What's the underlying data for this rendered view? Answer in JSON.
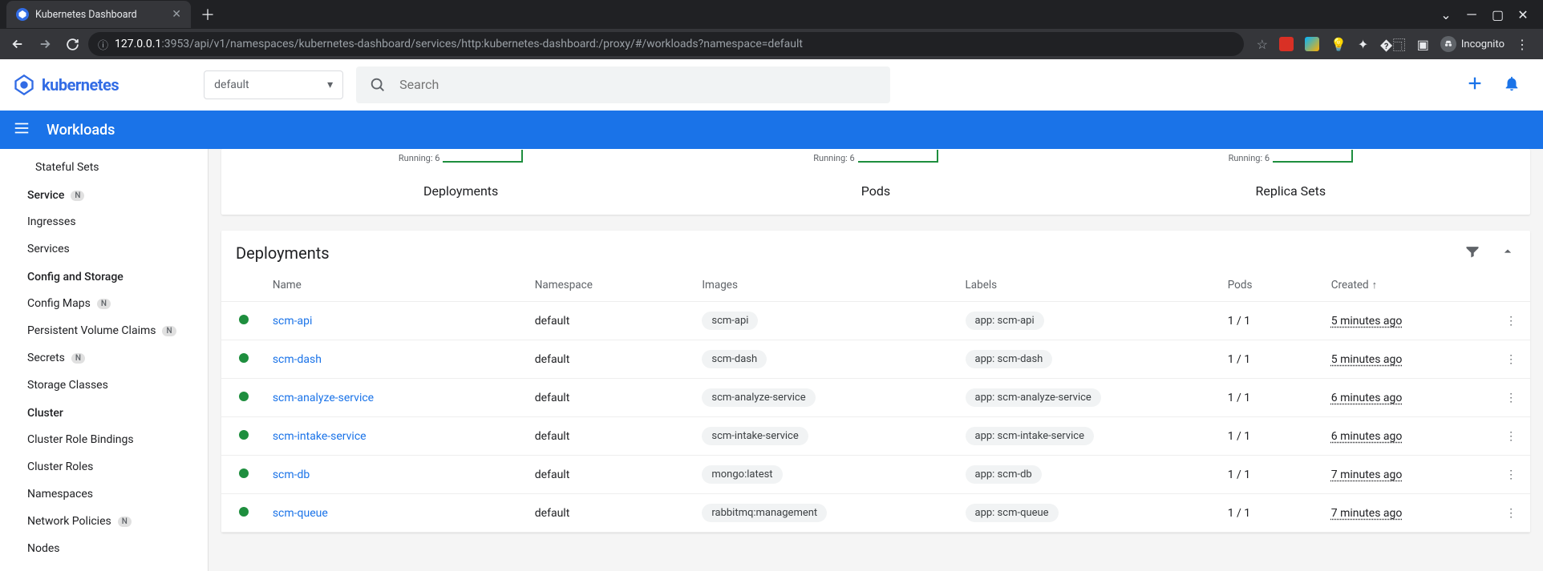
{
  "browser": {
    "tab_title": "Kubernetes Dashboard",
    "url_host": "127.0.0.1",
    "url_port": ":3953",
    "url_path": "/api/v1/namespaces/kubernetes-dashboard/services/http:kubernetes-dashboard:/proxy/#/workloads?namespace=default",
    "incognito_label": "Incognito"
  },
  "header": {
    "brand": "kubernetes",
    "namespace_selected": "default",
    "search_placeholder": "Search"
  },
  "page": {
    "title": "Workloads"
  },
  "sidebar": {
    "items": [
      {
        "label": "Stateful Sets",
        "type": "item"
      },
      {
        "label": "Service",
        "type": "section",
        "badge": "N"
      },
      {
        "label": "Ingresses",
        "type": "item"
      },
      {
        "label": "Services",
        "type": "item"
      },
      {
        "label": "Config and Storage",
        "type": "section"
      },
      {
        "label": "Config Maps",
        "type": "item",
        "badge": "N"
      },
      {
        "label": "Persistent Volume Claims",
        "type": "item",
        "badge": "N"
      },
      {
        "label": "Secrets",
        "type": "item",
        "badge": "N"
      },
      {
        "label": "Storage Classes",
        "type": "item"
      },
      {
        "label": "Cluster",
        "type": "section"
      },
      {
        "label": "Cluster Role Bindings",
        "type": "item"
      },
      {
        "label": "Cluster Roles",
        "type": "item"
      },
      {
        "label": "Namespaces",
        "type": "item"
      },
      {
        "label": "Network Policies",
        "type": "item",
        "badge": "N"
      },
      {
        "label": "Nodes",
        "type": "item"
      }
    ]
  },
  "status": {
    "cols": [
      {
        "running": "Running: 6",
        "title": "Deployments"
      },
      {
        "running": "Running: 6",
        "title": "Pods"
      },
      {
        "running": "Running: 6",
        "title": "Replica Sets"
      }
    ]
  },
  "deployments": {
    "title": "Deployments",
    "columns": {
      "name": "Name",
      "namespace": "Namespace",
      "images": "Images",
      "labels": "Labels",
      "pods": "Pods",
      "created": "Created"
    },
    "rows": [
      {
        "name": "scm-api",
        "namespace": "default",
        "image": "scm-api",
        "label": "app: scm-api",
        "pods": "1 / 1",
        "created": "5 minutes ago"
      },
      {
        "name": "scm-dash",
        "namespace": "default",
        "image": "scm-dash",
        "label": "app: scm-dash",
        "pods": "1 / 1",
        "created": "5 minutes ago"
      },
      {
        "name": "scm-analyze-service",
        "namespace": "default",
        "image": "scm-analyze-service",
        "label": "app: scm-analyze-service",
        "pods": "1 / 1",
        "created": "6 minutes ago"
      },
      {
        "name": "scm-intake-service",
        "namespace": "default",
        "image": "scm-intake-service",
        "label": "app: scm-intake-service",
        "pods": "1 / 1",
        "created": "6 minutes ago"
      },
      {
        "name": "scm-db",
        "namespace": "default",
        "image": "mongo:latest",
        "label": "app: scm-db",
        "pods": "1 / 1",
        "created": "7 minutes ago"
      },
      {
        "name": "scm-queue",
        "namespace": "default",
        "image": "rabbitmq:management",
        "label": "app: scm-queue",
        "pods": "1 / 1",
        "created": "7 minutes ago"
      }
    ]
  }
}
